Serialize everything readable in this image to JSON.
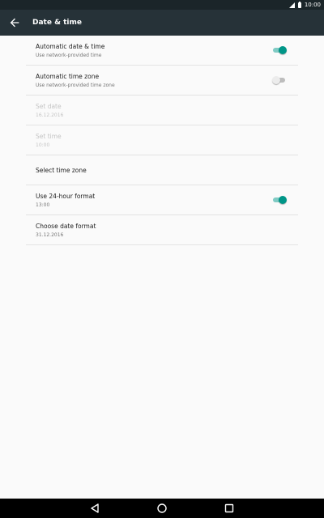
{
  "status_bar": {
    "time": "10:00",
    "icons": [
      "signal-icon",
      "battery-icon"
    ]
  },
  "toolbar": {
    "title": "Date & time",
    "back_icon": "arrow-left-icon"
  },
  "colors": {
    "toolbar": "#263238",
    "status_bar": "#1b2529",
    "accent": "#009688",
    "background": "#fafafa"
  },
  "settings": [
    {
      "id": "automatic-date-time",
      "title": "Automatic date & time",
      "subtitle": "Use network-provided time",
      "switch": "on",
      "enabled": true
    },
    {
      "id": "automatic-time-zone",
      "title": "Automatic time zone",
      "subtitle": "Use network-provided time zone",
      "switch": "off",
      "enabled": true
    },
    {
      "id": "set-date",
      "title": "Set date",
      "subtitle": "16.12.2016",
      "enabled": false
    },
    {
      "id": "set-time",
      "title": "Set time",
      "subtitle": "10:00",
      "enabled": false
    },
    {
      "id": "select-time-zone",
      "title": "Select time zone",
      "subtitle": "",
      "enabled": true
    },
    {
      "id": "use-24-hour-format",
      "title": "Use 24-hour format",
      "subtitle": "13:00",
      "switch": "on",
      "enabled": true
    },
    {
      "id": "choose-date-format",
      "title": "Choose date format",
      "subtitle": "31.12.2016",
      "enabled": true
    }
  ],
  "nav_bar": {
    "icons": [
      "back-triangle-icon",
      "home-circle-icon",
      "recents-square-icon"
    ]
  }
}
